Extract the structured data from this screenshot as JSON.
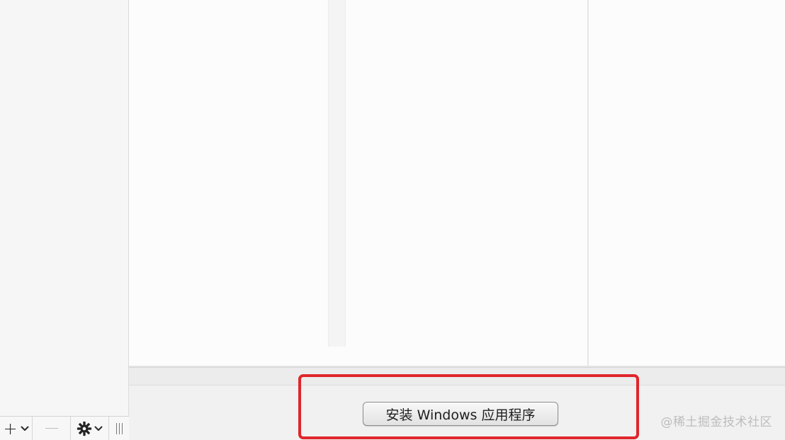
{
  "sidebar": {
    "toolbar": {
      "add_symbol": "+",
      "add_chevron": "⌄",
      "gear_symbol": "⚙",
      "gear_chevron": "⌄"
    }
  },
  "bottom_bar": {
    "install_button_label": "安装 Windows 应用程序"
  },
  "watermark": {
    "text": "@稀土掘金技术社区"
  },
  "colors": {
    "highlight": "#e0262b",
    "sidebar_bg": "#f6f6f6",
    "main_bg": "#fcfcfc",
    "bottom_bar_bg": "#ececec"
  }
}
